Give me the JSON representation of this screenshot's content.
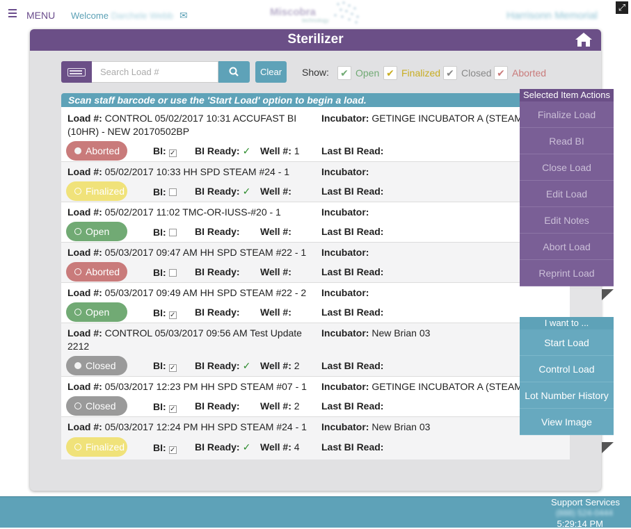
{
  "topbar": {
    "menu_label": "MENU",
    "welcome_prefix": "Welcome",
    "welcome_user": "Darchele Webb",
    "logo_word": "Miscobra",
    "logo_sub": "technology",
    "organization": "Harrisonn Memorial"
  },
  "panel": {
    "title": "Sterilizer"
  },
  "search": {
    "placeholder": "Search Load #",
    "clear_label": "Clear"
  },
  "filters": {
    "show_label": "Show:",
    "items": [
      {
        "label": "Open",
        "color": "#71aa74",
        "checked": true
      },
      {
        "label": "Finalized",
        "color": "#c8ad22",
        "checked": true
      },
      {
        "label": "Closed",
        "color": "#888888",
        "checked": true
      },
      {
        "label": "Aborted",
        "color": "#c97b7b",
        "checked": true
      }
    ]
  },
  "banner": "Scan staff barcode or use the 'Start Load' option to begin a load.",
  "labels": {
    "load": "Load #:",
    "incubator": "Incubator:",
    "bi": "BI:",
    "bi_ready": "BI Ready:",
    "well": "Well #:",
    "last_bi_read": "Last BI Read:"
  },
  "loads": [
    {
      "load": "CONTROL 05/02/2017 10:31 ACCUFAST BI (10HR) - NEW 20170502BP",
      "incubator": "GETINGE INCUBATOR A (STEAM)",
      "status": "Aborted",
      "bi_checked": true,
      "bi_ready": true,
      "well": "1"
    },
    {
      "load": "05/02/2017 10:33 HH SPD STEAM #24 - 1",
      "incubator": "",
      "status": "Finalized",
      "bi_checked": false,
      "bi_ready": true,
      "well": ""
    },
    {
      "load": "05/02/2017 11:02 TMC-OR-IUSS-#20 - 1",
      "incubator": "",
      "status": "Open",
      "bi_checked": false,
      "bi_ready": false,
      "well": ""
    },
    {
      "load": "05/03/2017 09:47 AM HH SPD STEAM #22 - 1",
      "incubator": "",
      "status": "Aborted",
      "bi_checked": false,
      "bi_ready": false,
      "well": ""
    },
    {
      "load": "05/03/2017 09:49 AM HH SPD STEAM #22 - 2",
      "incubator": "",
      "status": "Open",
      "bi_checked": true,
      "bi_ready": false,
      "well": ""
    },
    {
      "load": "CONTROL 05/03/2017 09:56 AM Test Update 2212",
      "incubator": "New Brian 03",
      "status": "Closed",
      "bi_checked": true,
      "bi_ready": true,
      "well": "2"
    },
    {
      "load": "05/03/2017 12:23 PM HH SPD STEAM #07 - 1",
      "incubator": "GETINGE INCUBATOR A (STEAM)",
      "status": "Closed",
      "bi_checked": true,
      "bi_ready": false,
      "well": "2"
    },
    {
      "load": "05/03/2017 12:24 PM HH SPD STEAM #24 - 1",
      "incubator": "New Brian 03",
      "status": "Finalized",
      "bi_checked": true,
      "bi_ready": true,
      "well": "4"
    }
  ],
  "selected_actions": {
    "title": "Selected Item Actions",
    "items": [
      "Finalize Load",
      "Read BI",
      "Close Load",
      "Edit Load",
      "Edit Notes",
      "Abort Load",
      "Reprint Load"
    ]
  },
  "i_want_to": {
    "title": "I want to ...",
    "items": [
      "Start Load",
      "Control Load",
      "Lot Number History",
      "View Image"
    ]
  },
  "footer": {
    "support": "Support Services",
    "phone": "(888) 524-0444",
    "time": "5:29:14 PM"
  }
}
